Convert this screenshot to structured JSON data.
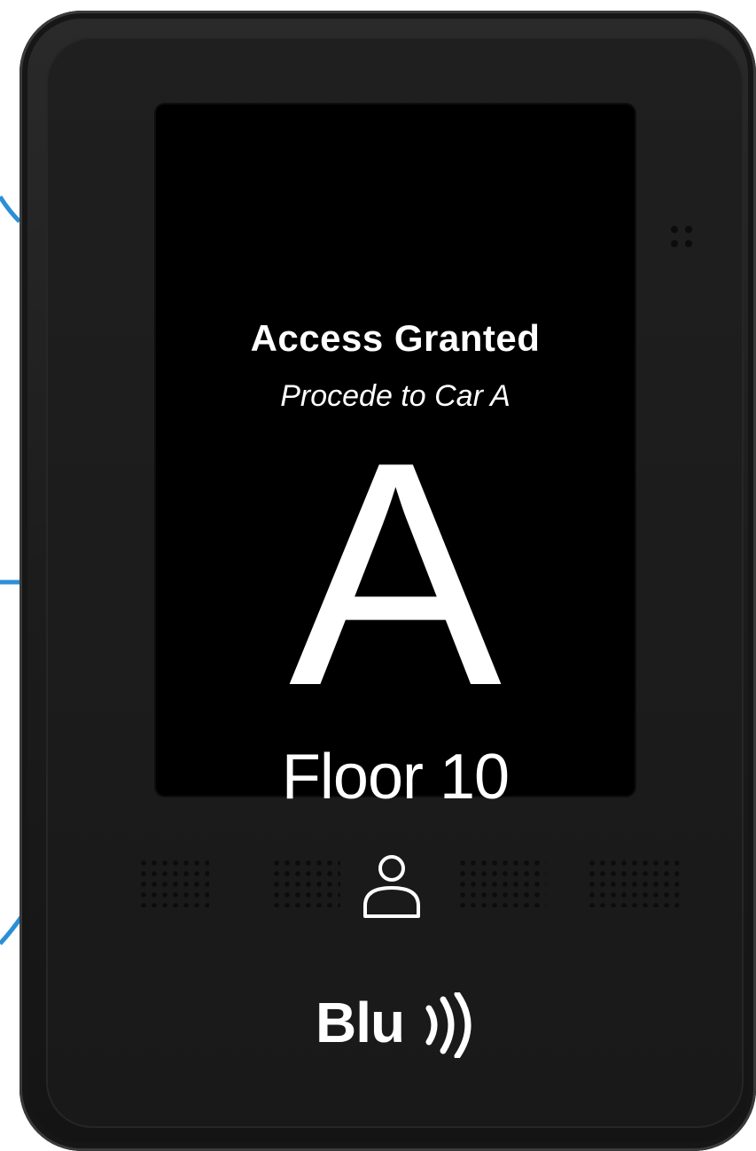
{
  "colors": {
    "connector": "#2b8fd6",
    "screen_bg": "#000000",
    "text": "#ffffff",
    "device_body": "#1c1c1c"
  },
  "screen": {
    "title": "Access Granted",
    "subtitle": "Procede to Car A",
    "car_letter": "A",
    "floor": "Floor 10"
  },
  "device": {
    "brand": "Blu",
    "brand_icon": "wireless-signal-icon",
    "center_icon": "person-icon"
  }
}
